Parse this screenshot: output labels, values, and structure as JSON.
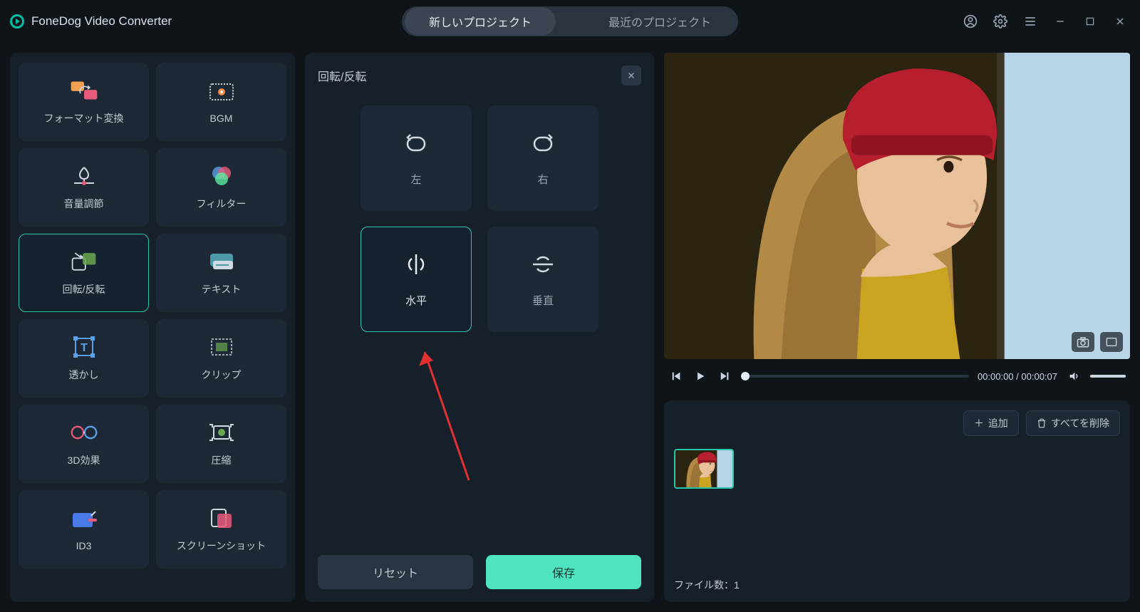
{
  "app": {
    "title": "FoneDog Video Converter"
  },
  "tabs": {
    "new_project": "新しいプロジェクト",
    "recent_project": "最近のプロジェクト"
  },
  "tools": {
    "format": "フォーマット変換",
    "bgm": "BGM",
    "volume": "音量調節",
    "filter": "フィルター",
    "rotate": "回転/反転",
    "text": "テキスト",
    "watermark": "透かし",
    "clip": "クリップ",
    "threeD": "3D効果",
    "compress": "圧縮",
    "id3": "ID3",
    "screenshot": "スクリーンショット"
  },
  "rotate_panel": {
    "title": "回転/反転",
    "left": "左",
    "right": "右",
    "horizontal": "水平",
    "vertical": "垂直",
    "reset": "リセット",
    "save": "保存"
  },
  "player": {
    "current": "00:00:00",
    "duration": "00:00:07"
  },
  "clips": {
    "add": "追加",
    "delete_all": "すべてを削除",
    "file_count_label": "ファイル数：",
    "file_count": "1"
  },
  "icons": {
    "user": "user-icon",
    "gear": "gear-icon",
    "menu": "menu-icon",
    "min": "minimize-icon",
    "max": "maximize-icon",
    "close": "close-icon",
    "camera": "camera-icon",
    "fullscreen": "fullscreen-icon",
    "prev": "skip-prev-icon",
    "play": "play-icon",
    "next": "skip-next-icon",
    "volume": "volume-icon",
    "plus": "plus-icon",
    "trash": "trash-icon"
  }
}
